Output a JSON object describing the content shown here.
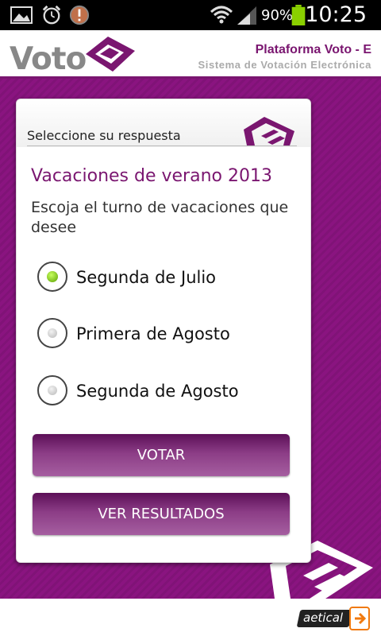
{
  "status_bar": {
    "battery_percent": "90%",
    "time": "10:25",
    "icons": [
      "image-icon",
      "alarm-icon",
      "warning-icon",
      "wifi-icon",
      "signal-icon",
      "battery-icon"
    ]
  },
  "header": {
    "logo_text": "Voto",
    "title": "Plataforma Voto - E",
    "subtitle": "Sistema de Votación Electrónica"
  },
  "card": {
    "label": "Seleccione su respuesta",
    "question_title": "Vacaciones de verano 2013",
    "question_text": "Escoja el turno de vacaciones que desee",
    "options": [
      {
        "label": "Segunda de Julio",
        "selected": true
      },
      {
        "label": "Primera de Agosto",
        "selected": false
      },
      {
        "label": "Segunda de Agosto",
        "selected": false
      }
    ],
    "vote_button": "VOTAR",
    "results_button": "VER RESULTADOS"
  },
  "footer": {
    "brand": "aetical"
  },
  "colors": {
    "brand_purple": "#7a1670",
    "background_purple": "#8a1480",
    "selected_radio": "#7dd62a"
  }
}
